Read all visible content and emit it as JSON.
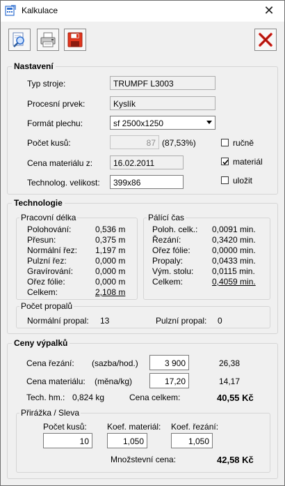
{
  "window": {
    "title": "Kalkulace",
    "close_glyph": "✕"
  },
  "toolbar": {
    "icons": [
      "search-document-icon",
      "printer-icon",
      "save-icon",
      "close-x-icon"
    ]
  },
  "nastaveni": {
    "title": "Nastavení",
    "typ_stroje": {
      "label": "Typ stroje:",
      "value": "TRUMPF L3003"
    },
    "procesni_prvek": {
      "label": "Procesní prvek:",
      "value": "Kyslík"
    },
    "format_plechu": {
      "label": "Formát plechu:",
      "value": "sf 2500x1250"
    },
    "pocet_kusu": {
      "label": "Počet kusů:",
      "value": "87",
      "percent": "(87,53%)"
    },
    "cena_materialu": {
      "label": "Cena materiálu z:",
      "value": "16.02.2011"
    },
    "technolog_velikost": {
      "label": "Technolog. velikost:",
      "value": "399x86"
    },
    "checkboxes": {
      "rucne": {
        "label": "ručně",
        "checked": false
      },
      "material": {
        "label": "materiál",
        "checked": true
      },
      "ulozit": {
        "label": "uložit",
        "checked": false
      }
    }
  },
  "technologie": {
    "title": "Technologie",
    "pracovni_delka": {
      "title": "Pracovní délka",
      "rows": [
        {
          "label": "Polohování:",
          "value": "0,536 m"
        },
        {
          "label": "Přesun:",
          "value": "0,375 m"
        },
        {
          "label": "Normální řez:",
          "value": "1,197 m"
        },
        {
          "label": "Pulzní řez:",
          "value": "0,000 m"
        },
        {
          "label": "Gravírování:",
          "value": "0,000 m"
        },
        {
          "label": "Ořez fólie:",
          "value": "0,000 m"
        },
        {
          "label": "Celkem:",
          "value": "2,108 m"
        }
      ]
    },
    "palici_cas": {
      "title": "Pálící čas",
      "rows": [
        {
          "label": "Poloh. celk.:",
          "value": "0,0091 min."
        },
        {
          "label": "Řezání:",
          "value": "0,3420 min."
        },
        {
          "label": "Ořez fólie:",
          "value": "0,0000 min."
        },
        {
          "label": "Propaly:",
          "value": "0,0433 min."
        },
        {
          "label": "Vým. stolu:",
          "value": "0,0115 min."
        },
        {
          "label": "Celkem:",
          "value": "0,4059 min."
        }
      ]
    },
    "pocet_propalu": {
      "title": "Počet propalů",
      "normalni_label": "Normální propal:",
      "normalni_value": "13",
      "pulzni_label": "Pulzní propal:",
      "pulzni_value": "0"
    }
  },
  "ceny": {
    "title": "Ceny výpalků",
    "cena_rezani": {
      "label": "Cena řezání:",
      "unit": "(sazba/hod.)",
      "input": "3 900",
      "result": "26,38"
    },
    "cena_materialu": {
      "label": "Cena materiálu:",
      "unit": "(měna/kg)",
      "input": "17,20",
      "result": "14,17"
    },
    "tech_hm": {
      "label": "Tech. hm.:",
      "value": "0,824 kg"
    },
    "cena_celkem": {
      "label": "Cena celkem:",
      "value": "40,55 Kč"
    },
    "prirazka": {
      "title": "Přirážka / Sleva",
      "pocet_kusu": {
        "label": "Počet kusů:",
        "value": "10"
      },
      "koef_material": {
        "label": "Koef. materiál:",
        "value": "1,050"
      },
      "koef_rezani": {
        "label": "Koef. řezání:",
        "value": "1,050"
      },
      "mnozstevni_cena": {
        "label": "Množstevní cena:",
        "value": "42,58 Kč"
      }
    }
  },
  "colors": {
    "save_red": "#e2351c",
    "close_red": "#d8231a",
    "icon_blue": "#2f6fd0"
  }
}
